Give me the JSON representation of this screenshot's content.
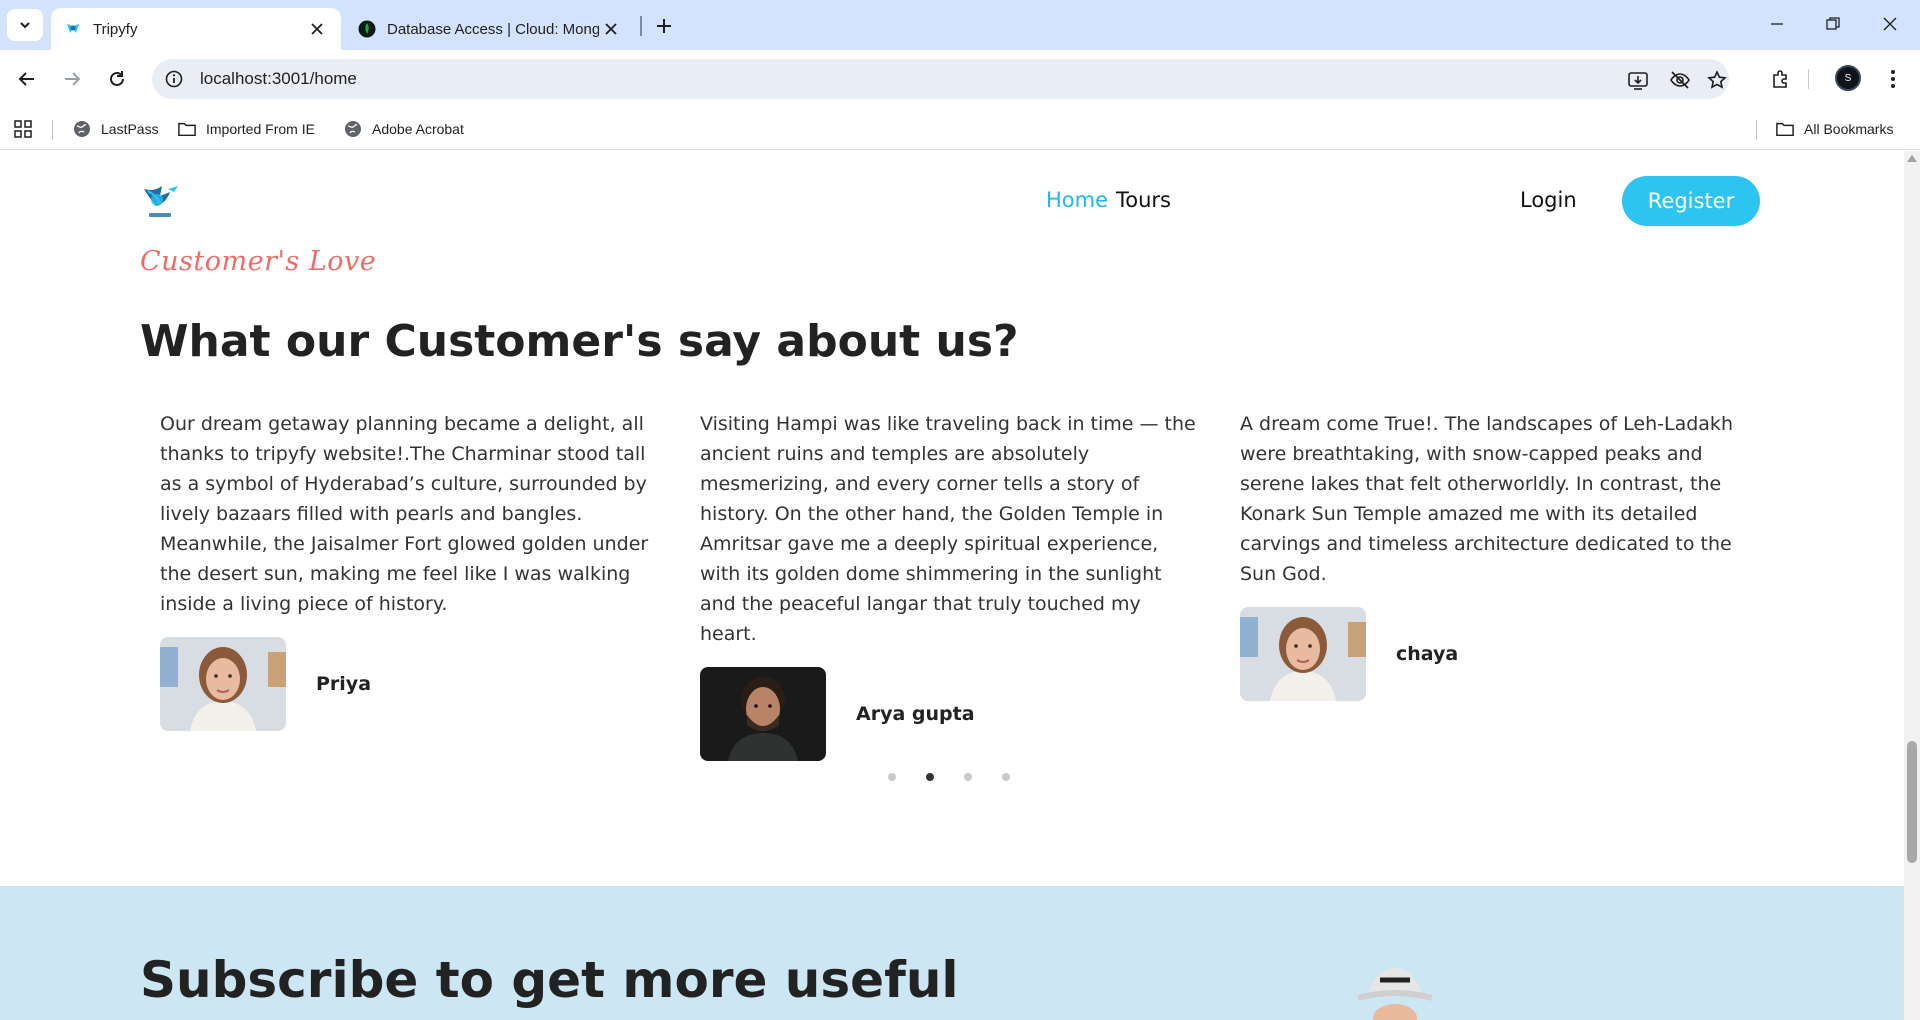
{
  "browser": {
    "tabs": [
      {
        "title": "Tripyfy",
        "active": true,
        "icon": "tripyfy-favicon"
      },
      {
        "title": "Database Access | Cloud: Mong",
        "active": false,
        "icon": "mongodb-leaf-icon"
      }
    ],
    "url": "localhost:3001/home",
    "bookmarks": [
      {
        "label": "LastPass",
        "icon": "globe-icon"
      },
      {
        "label": "Imported From IE",
        "icon": "folder-icon"
      },
      {
        "label": "Adobe Acrobat",
        "icon": "globe-icon"
      }
    ],
    "all_bookmarks_label": "All Bookmarks",
    "profile_initial": "S"
  },
  "header": {
    "nav": [
      "Home",
      "Tours"
    ],
    "login_label": "Login",
    "register_label": "Register"
  },
  "testimonials": {
    "subtitle": "Customer's Love",
    "title": "What our Customer's say about us?",
    "items": [
      {
        "quote": "Our dream getaway planning became a delight, all thanks to tripyfy website!.The Charminar stood tall as a symbol of Hyderabad’s culture, surrounded by lively bazaars filled with pearls and bangles. Meanwhile, the Jaisalmer Fort glowed golden under the desert sun, making me feel like I was walking inside a living piece of history.",
        "name": "Priya"
      },
      {
        "quote": "Visiting Hampi was like traveling back in time — the ancient ruins and temples are absolutely mesmerizing, and every corner tells a story of history. On the other hand, the Golden Temple in Amritsar gave me a deeply spiritual experience, with its golden dome shimmering in the sunlight and the peaceful langar that truly touched my heart.",
        "name": "Arya gupta"
      },
      {
        "quote": "A dream come True!. The landscapes of Leh-Ladakh were breathtaking, with snow-capped peaks and serene lakes that felt otherworldly. In contrast, the Konark Sun Temple amazed me with its detailed carvings and timeless architecture dedicated to the Sun God.",
        "name": "chaya"
      }
    ],
    "active_dot": 1,
    "dot_count": 4
  },
  "newsletter": {
    "title": "Subscribe to get more useful"
  },
  "colors": {
    "accent": "#2ec4f1",
    "subtitle": "#f06b66",
    "newsletter_bg": "#cce6f4"
  }
}
